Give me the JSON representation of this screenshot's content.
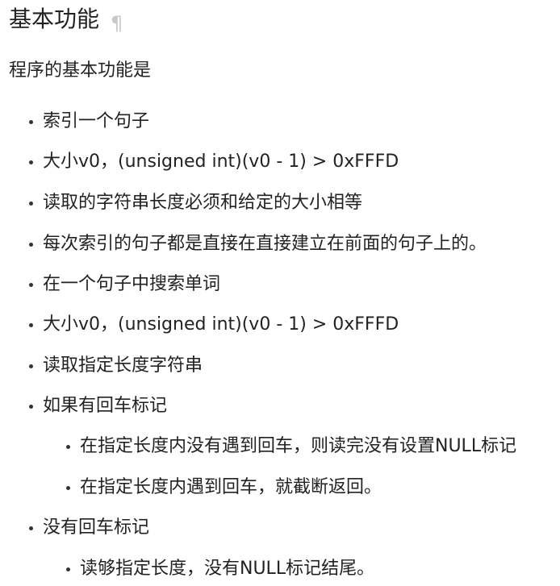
{
  "heading": {
    "title": "基本功能",
    "anchor_symbol": "¶"
  },
  "intro": "程序的基本功能是",
  "list": [
    {
      "text": "索引一个句子"
    },
    {
      "text": "大小v0，(unsigned int)(v0 - 1) > 0xFFFD"
    },
    {
      "text": "读取的字符串长度必须和给定的大小相等"
    },
    {
      "text": "每次索引的句子都是直接在直接建立在前面的句子上的。"
    },
    {
      "text": "在一个句子中搜索单词"
    },
    {
      "text": "大小v0，(unsigned int)(v0 - 1) > 0xFFFD"
    },
    {
      "text": "读取指定长度字符串"
    },
    {
      "text": "如果有回车标记",
      "children": [
        {
          "text": "在指定长度内没有遇到回车，则读完没有设置NULL标记"
        },
        {
          "text": "在指定长度内遇到回车，就截断返回。"
        }
      ]
    },
    {
      "text": "没有回车标记",
      "children": [
        {
          "text": "读够指定长度，没有NULL标记结尾。"
        }
      ]
    }
  ]
}
